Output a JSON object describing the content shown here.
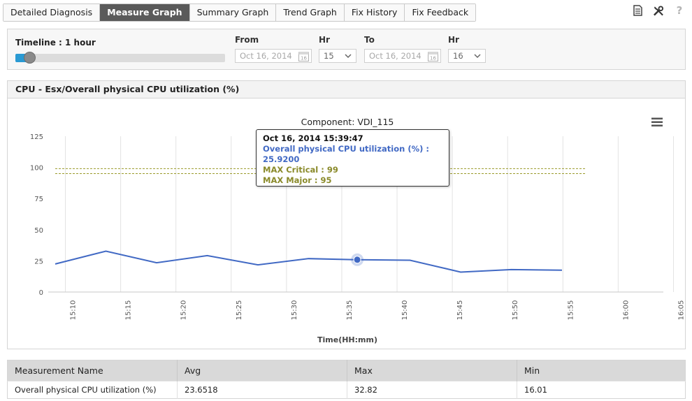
{
  "tabs": [
    {
      "label": "Detailed Diagnosis",
      "active": false
    },
    {
      "label": "Measure Graph",
      "active": true
    },
    {
      "label": "Summary Graph",
      "active": false
    },
    {
      "label": "Trend Graph",
      "active": false
    },
    {
      "label": "Fix History",
      "active": false
    },
    {
      "label": "Fix Feedback",
      "active": false
    }
  ],
  "toolbar": {
    "icons": [
      "document-icon",
      "tools-icon",
      "help-icon"
    ],
    "help_label": "?"
  },
  "timeline": {
    "label": "Timeline : 1 hour",
    "slider_value": 0.07,
    "from_label": "From",
    "from_date": "Oct 16, 2014",
    "from_hr_label": "Hr",
    "from_hr": "15",
    "to_label": "To",
    "to_date": "Oct 16, 2014",
    "to_hr_label": "Hr",
    "to_hr": "16",
    "calendar_day": "16"
  },
  "graph": {
    "header": "CPU - Esx/Overall physical CPU utilization (%)"
  },
  "tooltip": {
    "date": "Oct 16, 2014 15:39:47",
    "series_line": "Overall physical CPU utilization (%) : 25.9200",
    "critical_line": "MAX Critical : 99",
    "major_line": "MAX Major : 95"
  },
  "colors": {
    "series": "#4169c4",
    "threshold": "#9a9a2a",
    "accent": "#2a9ad3",
    "active_tab": "#5a5a5a"
  },
  "chart_data": {
    "type": "line",
    "title": "Component: VDI_115",
    "xlabel": "Time(HH:mm)",
    "ylabel": "",
    "ylim": [
      0,
      125
    ],
    "yticks": [
      "0",
      "25",
      "50",
      "75",
      "100",
      "125"
    ],
    "xticks": [
      "15:10",
      "15:15",
      "15:20",
      "15:25",
      "15:30",
      "15:35",
      "15:40",
      "15:45",
      "15:50",
      "15:55",
      "16:00",
      "16:05"
    ],
    "x_range_minutes": [
      0,
      60
    ],
    "series": [
      {
        "name": "Overall physical CPU utilization (%)",
        "x_minutes": [
          0,
          5,
          10,
          15,
          20,
          25,
          29.8,
          35,
          40,
          45,
          50
        ],
        "values": [
          22.5,
          32.8,
          23.5,
          29.2,
          21.8,
          26.8,
          25.92,
          25.5,
          16.01,
          18.0,
          17.5
        ],
        "highlight_index": 6
      }
    ],
    "thresholds": [
      {
        "name": "MAX Critical",
        "value": 99
      },
      {
        "name": "MAX Major",
        "value": 95
      }
    ],
    "grid": true
  },
  "table": {
    "columns": [
      "Measurement Name",
      "Avg",
      "Max",
      "Min"
    ],
    "rows": [
      [
        "Overall physical CPU utilization (%)",
        "23.6518",
        "32.82",
        "16.01"
      ]
    ]
  }
}
